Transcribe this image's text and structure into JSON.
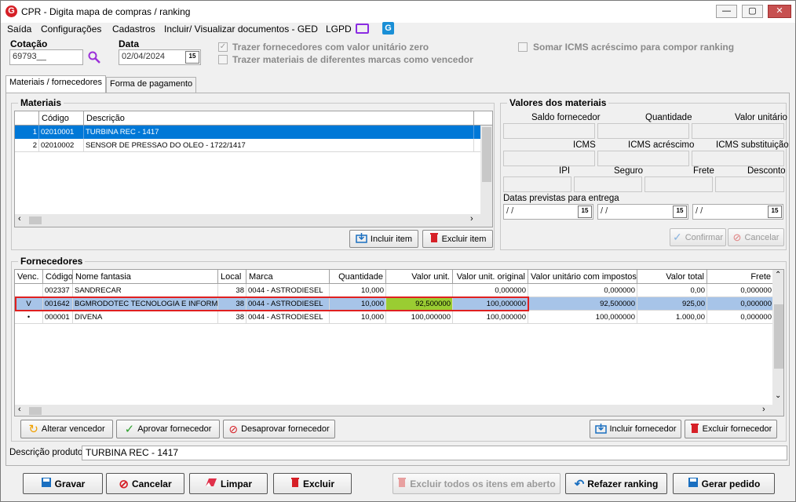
{
  "window": {
    "title": "CPR - Digita mapa de compras / ranking"
  },
  "menu": [
    "Saída",
    "Configurações",
    "Cadastros",
    "Incluir/ Visualizar documentos - GED",
    "LGPD"
  ],
  "header": {
    "cotacao_label": "Cotação",
    "cotacao_value": "69793__",
    "data_label": "Data",
    "data_value": "02/04/2024",
    "opt_valor_zero": "Trazer fornecedores com valor unitário zero",
    "opt_marcas": "Trazer materiais de diferentes marcas como vencedor",
    "opt_icms": "Somar ICMS acréscimo para compor ranking"
  },
  "tabs": [
    "Materiais / fornecedores",
    "Forma de pagamento"
  ],
  "materiais": {
    "title": "Materiais",
    "columns": [
      "Código",
      "Descrição"
    ],
    "rows": [
      {
        "n": "1",
        "codigo": "02010001",
        "descricao": "TURBINA REC - 1417"
      },
      {
        "n": "2",
        "codigo": "02010002",
        "descricao": "SENSOR DE PRESSAO DO OLEO - 1722/1417"
      }
    ],
    "incluir": "Incluir item",
    "excluir": "Excluir item"
  },
  "valores": {
    "title": "Valores dos materiais",
    "saldo": "Saldo fornecedor",
    "quantidade": "Quantidade",
    "valor_unitario": "Valor unitário",
    "icms": "ICMS",
    "icms_acrescimo": "ICMS acréscimo",
    "icms_subst": "ICMS substituição",
    "ipi": "IPI",
    "seguro": "Seguro",
    "frete": "Frete",
    "desconto": "Desconto",
    "datas": "Datas previstas para entrega",
    "date_empty": " / /",
    "confirmar": "Confirmar",
    "cancelar": "Cancelar"
  },
  "fornecedores": {
    "title": "Fornecedores",
    "columns": [
      "Venc.",
      "Código",
      "Nome fantasia",
      "Local",
      "Marca",
      "Quantidade",
      "Valor unit.",
      "Valor unit. original",
      "Valor unitário com impostos",
      "Valor total",
      "Frete"
    ],
    "rows": [
      {
        "venc": "",
        "codigo": "002337",
        "nome": "SANDRECAR",
        "local": "38",
        "marca": "0044 - ASTRODIESEL",
        "qtd": "10,000",
        "vunit": "",
        "vorig": "0,000000",
        "vimp": "0,000000",
        "vtotal": "0,00",
        "frete": "0,000000"
      },
      {
        "venc": "V",
        "codigo": "001642",
        "nome": "BGMRODOTEC TECNOLOGIA E INFORM",
        "local": "38",
        "marca": "0044 - ASTRODIESEL",
        "qtd": "10,000",
        "vunit": "92,500000",
        "vorig": "100,000000",
        "vimp": "92,500000",
        "vtotal": "925,00",
        "frete": "0,000000"
      },
      {
        "venc": "•",
        "codigo": "000001",
        "nome": "DIVENA",
        "local": "38",
        "marca": "0044 - ASTRODIESEL",
        "qtd": "10,000",
        "vunit": "100,000000",
        "vorig": "100,000000",
        "vimp": "100,000000",
        "vtotal": "1.000,00",
        "frete": "0,000000"
      }
    ],
    "alterar": "Alterar vencedor",
    "aprovar": "Aprovar fornecedor",
    "desaprovar": "Desaprovar fornecedor",
    "incluir": "Incluir fornecedor",
    "excluir": "Excluir fornecedor"
  },
  "descricao": {
    "label": "Descrição produto",
    "value": "TURBINA REC - 1417"
  },
  "footer": {
    "gravar": "Gravar",
    "cancelar": "Cancelar",
    "limpar": "Limpar",
    "excluir": "Excluir",
    "excluir_todos": "Excluir todos os itens em aberto",
    "refazer": "Refazer ranking",
    "gerar": "Gerar pedido"
  },
  "colors": {
    "selection": "#0078d7",
    "highlight_row": "#a7c4e8",
    "green_cell": "#9acd32",
    "red_border": "#e02020"
  }
}
